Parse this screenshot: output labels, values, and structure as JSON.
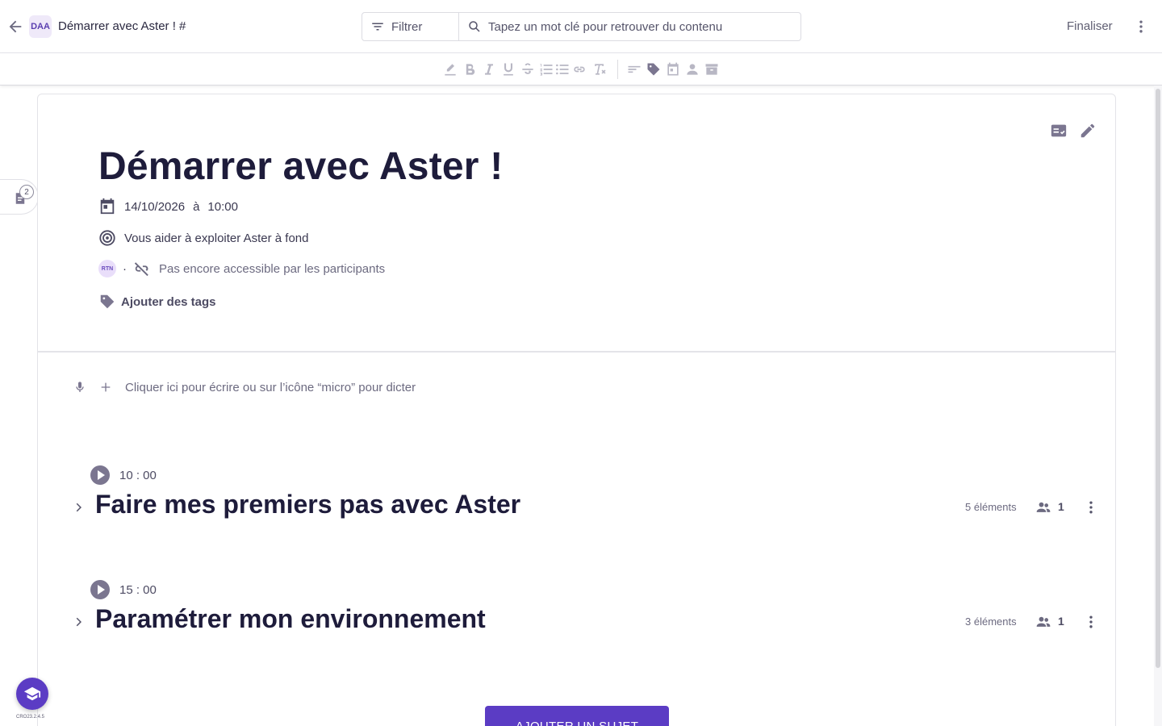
{
  "topbar": {
    "avatar_initials": "DAA",
    "doc_title": "Démarrer avec Aster ! #",
    "filter_label": "Filtrer",
    "search_placeholder": "Tapez un mot clé pour retrouver du contenu",
    "finalize_label": "Finaliser"
  },
  "side": {
    "notes_count": "2"
  },
  "meeting": {
    "title": "Démarrer avec Aster !",
    "date": "14/10/2026",
    "at_label": "à",
    "time": "10:00",
    "objective": "Vous aider à exploiter Aster à fond",
    "owner_initials": "RTN",
    "separator": "·",
    "access_status": "Pas encore accessible par les participants",
    "add_tags_label": "Ajouter des tags"
  },
  "editor": {
    "hint": "Cliquer ici pour écrire ou sur l’icône “micro” pour dicter"
  },
  "subjects": [
    {
      "time": "10 : 00",
      "title": "Faire mes premiers pas avec Aster",
      "items_count": "5 éléments",
      "participants": "1"
    },
    {
      "time": "15 : 00",
      "title": "Paramétrer mon environnement",
      "items_count": "3 éléments",
      "participants": "1"
    }
  ],
  "add_subject_label": "AJOUTER UN SUJET",
  "version": "CRO23.2.4.5",
  "colors": {
    "accent": "#5b3cc4",
    "text_dark": "#1e1c3b",
    "icon_gray": "#8c8a9c"
  }
}
